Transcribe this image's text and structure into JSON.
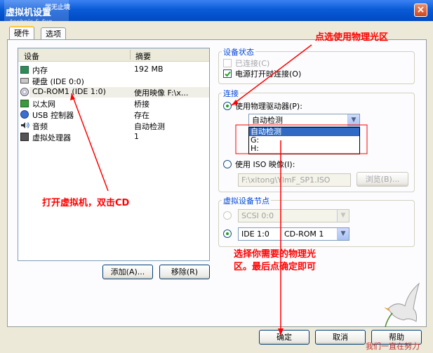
{
  "window": {
    "title": "虚拟机设置",
    "close_glyph": "×"
  },
  "watermark_top": {
    "line1": "学无止境",
    "line2": "technic & fun"
  },
  "tabs": [
    {
      "label": "硬件"
    },
    {
      "label": "选项"
    }
  ],
  "device_list": {
    "headers": {
      "device": "设备",
      "summary": "摘要"
    },
    "rows": [
      {
        "device": "内存",
        "summary": "192 MB"
      },
      {
        "device": "硬盘 (IDE 0:0)",
        "summary": ""
      },
      {
        "device": "CD-ROM1 (IDE 1:0)",
        "summary": "使用映像 F:\\x..."
      },
      {
        "device": "以太网",
        "summary": "桥接"
      },
      {
        "device": "USB 控制器",
        "summary": "存在"
      },
      {
        "device": "音频",
        "summary": "自动检测"
      },
      {
        "device": "虚拟处理器",
        "summary": "1"
      }
    ]
  },
  "buttons": {
    "add": "添加(A)...",
    "remove": "移除(R)",
    "ok": "确定",
    "cancel": "取消",
    "help": "帮助"
  },
  "device_status": {
    "title": "设备状态",
    "connected": {
      "label": "已连接(C)",
      "checked": false,
      "enabled": false
    },
    "connect_at_power_on": {
      "label": "电源打开时连接(O)",
      "checked": true
    }
  },
  "connection": {
    "title": "连接",
    "physical": {
      "label": "使用物理驱动器(P):",
      "selected": true
    },
    "physical_combo_value": "自动检测",
    "physical_options": [
      "自动检测",
      "G:",
      "H:"
    ],
    "iso": {
      "label": "使用 ISO 映像(I):",
      "selected": false
    },
    "iso_path": "F:\\xitong\\YlmF_SP1.ISO",
    "browse": "浏览(B)..."
  },
  "virtual_node": {
    "title": "虚拟设备节点",
    "scsi_value": "SCSI 0:0",
    "ide_value": "IDE 1:0",
    "ide_device": "CD-ROM 1"
  },
  "annotations": {
    "top": "点选使用物理光区",
    "left": "打开虚拟机，双击CD",
    "bottom_line1": "选择你需要的物理光",
    "bottom_line2": "区。最后点确定即可"
  },
  "watermark_bottom": "我们一直在努力",
  "colors": {
    "annotation": "#ff0000",
    "accent": "#0046d5",
    "titlebar": "#0a5bd6"
  }
}
